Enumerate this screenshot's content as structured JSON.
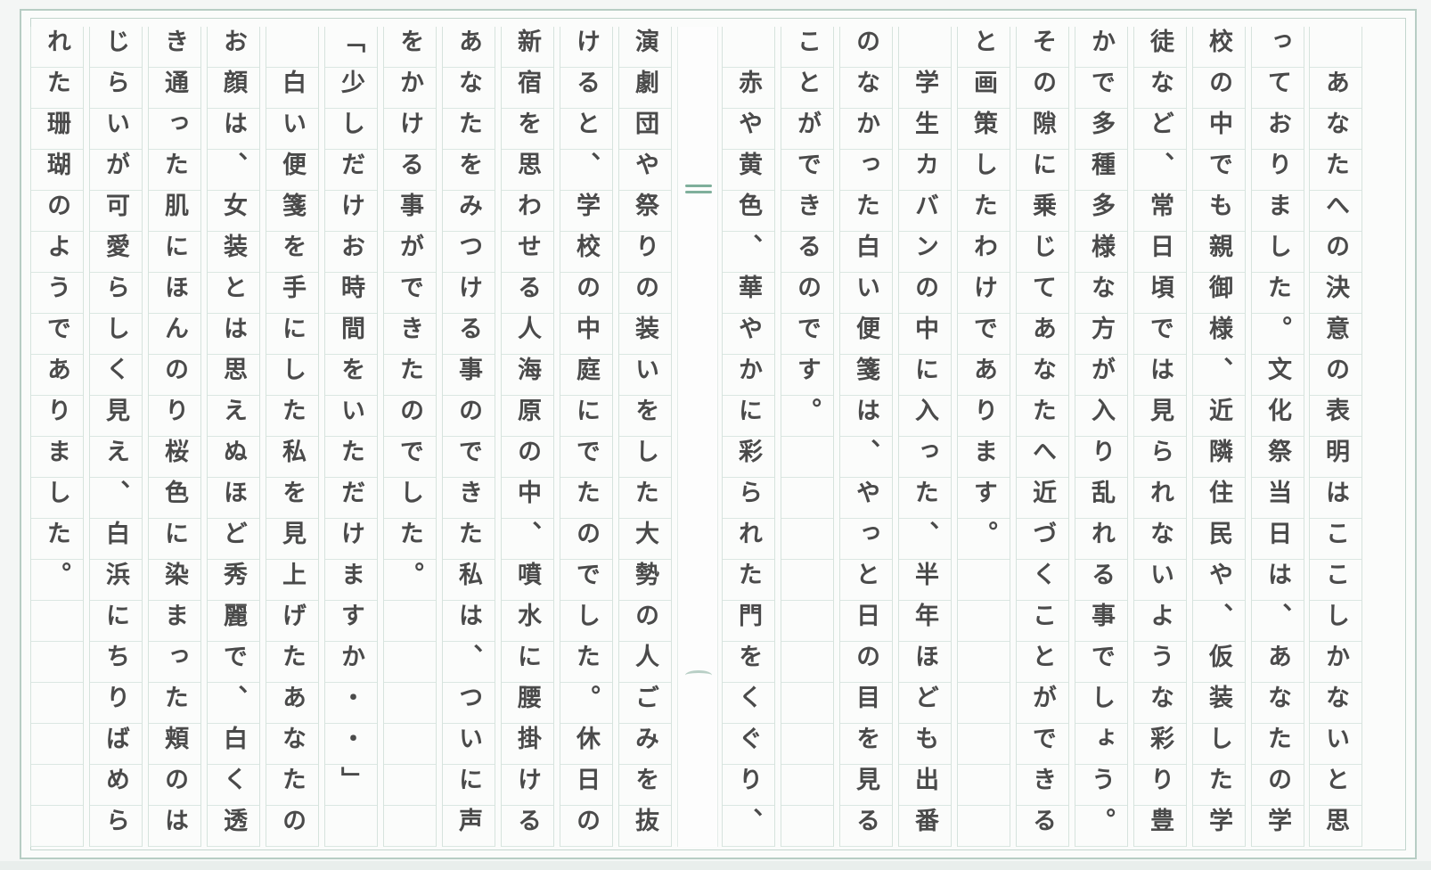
{
  "columns": [
    "　あなたへの決意の表明はここしかないと思",
    "っておりました。文化祭当日は、あなたの学",
    "校の中でも親御様、近隣住民や、仮装した学",
    "徒など、常日頃では見られないような彩り豊",
    "かで多種多様な方が入り乱れる事でしょう。",
    "その隙に乗じてあなたへ近づくことができる",
    "と画策したわけであります。",
    "　学生カバンの中に入った、半年ほども出番",
    "のなかった白い便箋は、やっと日の目を見る",
    "ことができるのです。",
    "　赤や黄色、華やかに彩られた門をくぐり、",
    "",
    "演劇団や祭りの装いをした大勢の人ごみを抜",
    "けると、学校の中庭にでたのでした。休日の",
    "新宿を思わせる人海原の中、噴水に腰掛ける",
    "あなたをみつける事のできた私は、ついに声",
    "をかける事ができたのでした。",
    "「少しだけお時間をいただけますか・・」",
    "　白い便箋を手にした私を見上げたあなたの",
    "お顔は、女装とは思えぬほど秀麗で、白く透",
    "き通った肌にほんのり桜色に染まった頬のは",
    "じらいが可愛らしく見え、白浜にちりばめら",
    "れた珊瑚のようでありました。"
  ]
}
